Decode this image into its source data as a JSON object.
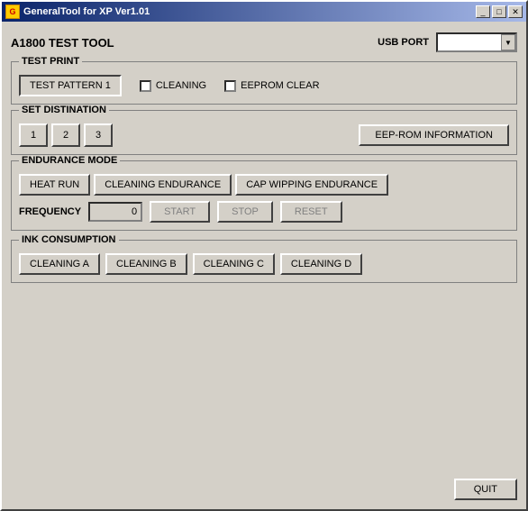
{
  "window": {
    "title": "GeneralTool for XP Ver1.01",
    "minimize_label": "_",
    "maximize_label": "□",
    "close_label": "✕"
  },
  "app_title": "A1800 TEST TOOL",
  "usb": {
    "label": "USB PORT",
    "options": [
      ""
    ],
    "placeholder": ""
  },
  "test_print": {
    "group_label": "TEST PRINT",
    "button_label": "TEST PATTERN 1",
    "cleaning_label": "CLEANING",
    "eeprom_label": "EEPROM CLEAR"
  },
  "set_destination": {
    "group_label": "SET DISTINATION",
    "buttons": [
      "1",
      "2",
      "3"
    ],
    "eeprom_button": "EEP-ROM INFORMATION"
  },
  "endurance_mode": {
    "group_label": "ENDURANCE MODE",
    "heat_run_label": "HEAT RUN",
    "cleaning_endurance_label": "CLEANING ENDURANCE",
    "cap_wipping_label": "CAP WIPPING ENDURANCE",
    "frequency_label": "FREQUENCY",
    "frequency_value": "0",
    "start_label": "START",
    "stop_label": "STOP",
    "reset_label": "RESET"
  },
  "ink_consumption": {
    "group_label": "INK CONSUMPTION",
    "buttons": [
      "CLEANING A",
      "CLEANING B",
      "CLEANING C",
      "CLEANING D"
    ]
  },
  "quit": {
    "label": "QUIT"
  }
}
